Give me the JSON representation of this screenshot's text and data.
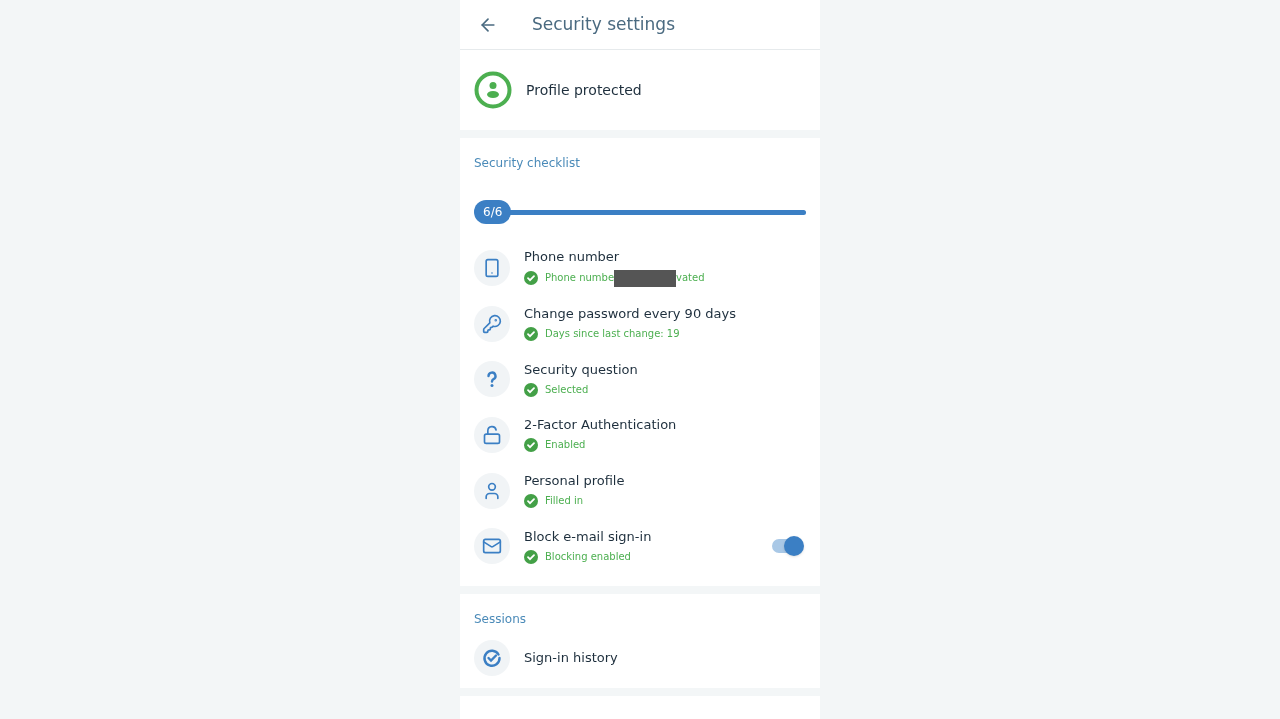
{
  "header": {
    "title": "Security settings"
  },
  "profile": {
    "status": "Profile protected"
  },
  "checklist": {
    "title": "Security checklist",
    "progress_label": "6/6",
    "level": 1,
    "items": [
      {
        "kind": "phone",
        "title": "Phone number",
        "status": "Phone numbe",
        "redacted": true,
        "status_after": "vated",
        "done": true
      },
      {
        "kind": "key",
        "title": "Change password every 90 days",
        "status": "Days since last change: 19",
        "done": true
      },
      {
        "kind": "question",
        "title": "Security question",
        "status": "Selected",
        "done": true
      },
      {
        "kind": "lock",
        "title": "2-Factor Authentication",
        "status": "Enabled",
        "done": true
      },
      {
        "kind": "person",
        "title": "Personal profile",
        "status": "Filled in",
        "done": true
      },
      {
        "kind": "mail",
        "title": "Block e-mail sign-in",
        "status": "Blocking enabled",
        "done": true,
        "on": true
      }
    ]
  },
  "sessions": {
    "title": "Sessions",
    "items": [
      {
        "title": "Sign-in history"
      }
    ]
  }
}
